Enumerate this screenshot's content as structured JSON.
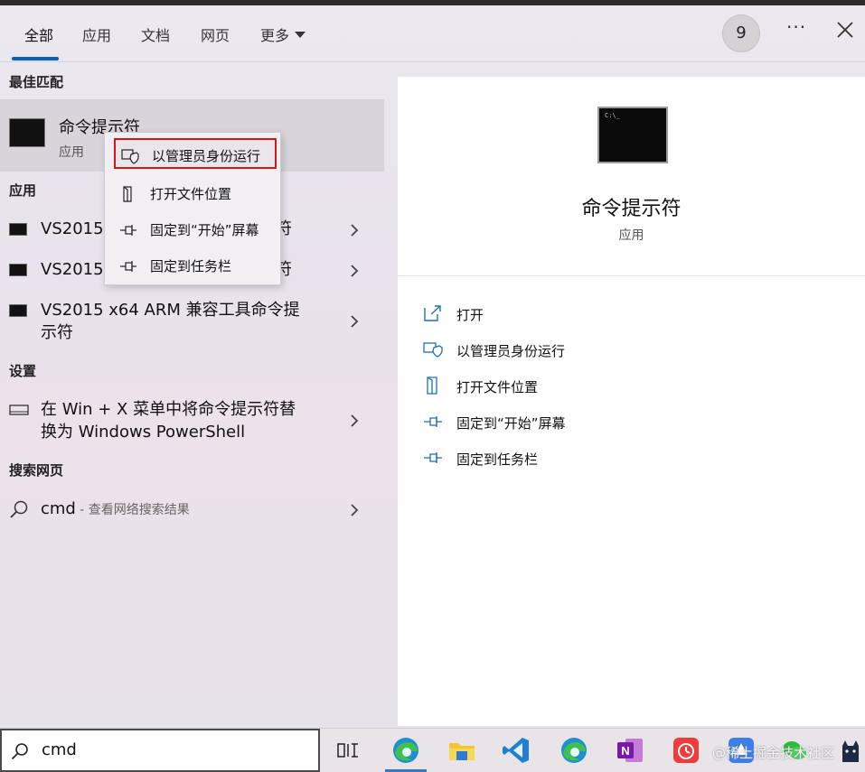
{
  "tabs": [
    {
      "label": "全部"
    },
    {
      "label": "应用"
    },
    {
      "label": "文档"
    },
    {
      "label": "网页"
    },
    {
      "label": "更多"
    }
  ],
  "header": {
    "badge": "9",
    "dots": "···"
  },
  "sections": {
    "best_match": "最佳匹配",
    "apps": "应用",
    "settings": "设置",
    "web": "搜索网页"
  },
  "best_match": {
    "title": "命令提示符",
    "subtitle": "应用"
  },
  "apps": [
    {
      "label": "VS2015",
      "tail": "符"
    },
    {
      "label": "VS2015",
      "tail": "符"
    },
    {
      "label_line1": "VS2015 x64 ARM 兼容工具命令提",
      "label_line2": "示符"
    }
  ],
  "setting_item": {
    "line1": "在 Win + X 菜单中将命令提示符替",
    "line2": "换为 Windows PowerShell"
  },
  "web_item": {
    "query": "cmd",
    "hint": " - 查看网络搜索结果"
  },
  "context_menu": [
    {
      "label": "以管理员身份运行",
      "icon": "shield-icon",
      "selected": true
    },
    {
      "label": "打开文件位置",
      "icon": "folder-icon"
    },
    {
      "label": "固定到“开始”屏幕",
      "icon": "pin-icon"
    },
    {
      "label": "固定到任务栏",
      "icon": "pin-icon"
    }
  ],
  "preview": {
    "title": "命令提示符",
    "subtitle": "应用",
    "actions": [
      {
        "label": "打开",
        "icon": "open-icon"
      },
      {
        "label": "以管理员身份运行",
        "icon": "shield-icon"
      },
      {
        "label": "打开文件位置",
        "icon": "folder-icon"
      },
      {
        "label": "固定到“开始”屏幕",
        "icon": "pin-icon"
      },
      {
        "label": "固定到任务栏",
        "icon": "pin-icon"
      }
    ]
  },
  "taskbar": {
    "search_value": "cmd",
    "watermark": "@稀土掘金技术社区",
    "apps": [
      "task-view-icon",
      "edge-icon",
      "file-explorer-icon",
      "vscode-icon",
      "edge-icon",
      "onenote-icon",
      "calendar-app-icon",
      "app-icon",
      "wechat-icon",
      "cat-icon"
    ]
  },
  "colors": {
    "accent": "#0b5fb5",
    "selection_outline": "#d01818",
    "action_icon": "#1e6fc0"
  }
}
